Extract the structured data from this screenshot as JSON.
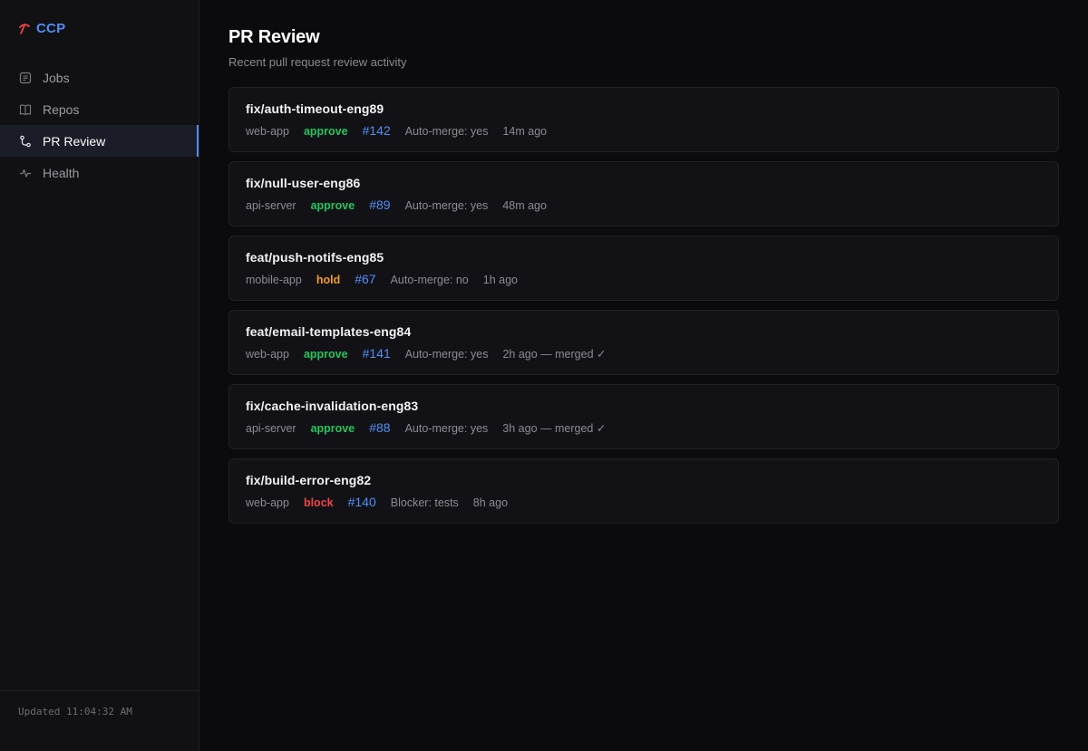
{
  "brand": {
    "name": "CCP",
    "icon": "pickaxe-icon",
    "accent": "#4f8ff7"
  },
  "nav": [
    {
      "key": "jobs",
      "label": "Jobs",
      "icon": "document-icon",
      "active": false
    },
    {
      "key": "repos",
      "label": "Repos",
      "icon": "book-icon",
      "active": false
    },
    {
      "key": "pr-review",
      "label": "PR Review",
      "icon": "git-pull-request-icon",
      "active": true
    },
    {
      "key": "health",
      "label": "Health",
      "icon": "pulse-icon",
      "active": false
    }
  ],
  "footer": {
    "updated": "Updated 11:04:32 AM"
  },
  "page": {
    "title": "PR Review",
    "subtitle": "Recent pull request review activity"
  },
  "colors": {
    "approve": "#22c55e",
    "hold": "#f59e0b",
    "block": "#ef4444",
    "link": "#4f8ff7"
  },
  "prs": [
    {
      "branch": "fix/auth-timeout-eng89",
      "repo": "web-app",
      "verdict": "approve",
      "number": "#142",
      "detail": "Auto-merge: yes",
      "time": "14m ago"
    },
    {
      "branch": "fix/null-user-eng86",
      "repo": "api-server",
      "verdict": "approve",
      "number": "#89",
      "detail": "Auto-merge: yes",
      "time": "48m ago"
    },
    {
      "branch": "feat/push-notifs-eng85",
      "repo": "mobile-app",
      "verdict": "hold",
      "number": "#67",
      "detail": "Auto-merge: no",
      "time": "1h ago"
    },
    {
      "branch": "feat/email-templates-eng84",
      "repo": "web-app",
      "verdict": "approve",
      "number": "#141",
      "detail": "Auto-merge: yes",
      "time": "2h ago — merged ✓"
    },
    {
      "branch": "fix/cache-invalidation-eng83",
      "repo": "api-server",
      "verdict": "approve",
      "number": "#88",
      "detail": "Auto-merge: yes",
      "time": "3h ago — merged ✓"
    },
    {
      "branch": "fix/build-error-eng82",
      "repo": "web-app",
      "verdict": "block",
      "number": "#140",
      "detail": "Blocker: tests",
      "time": "8h ago"
    }
  ]
}
